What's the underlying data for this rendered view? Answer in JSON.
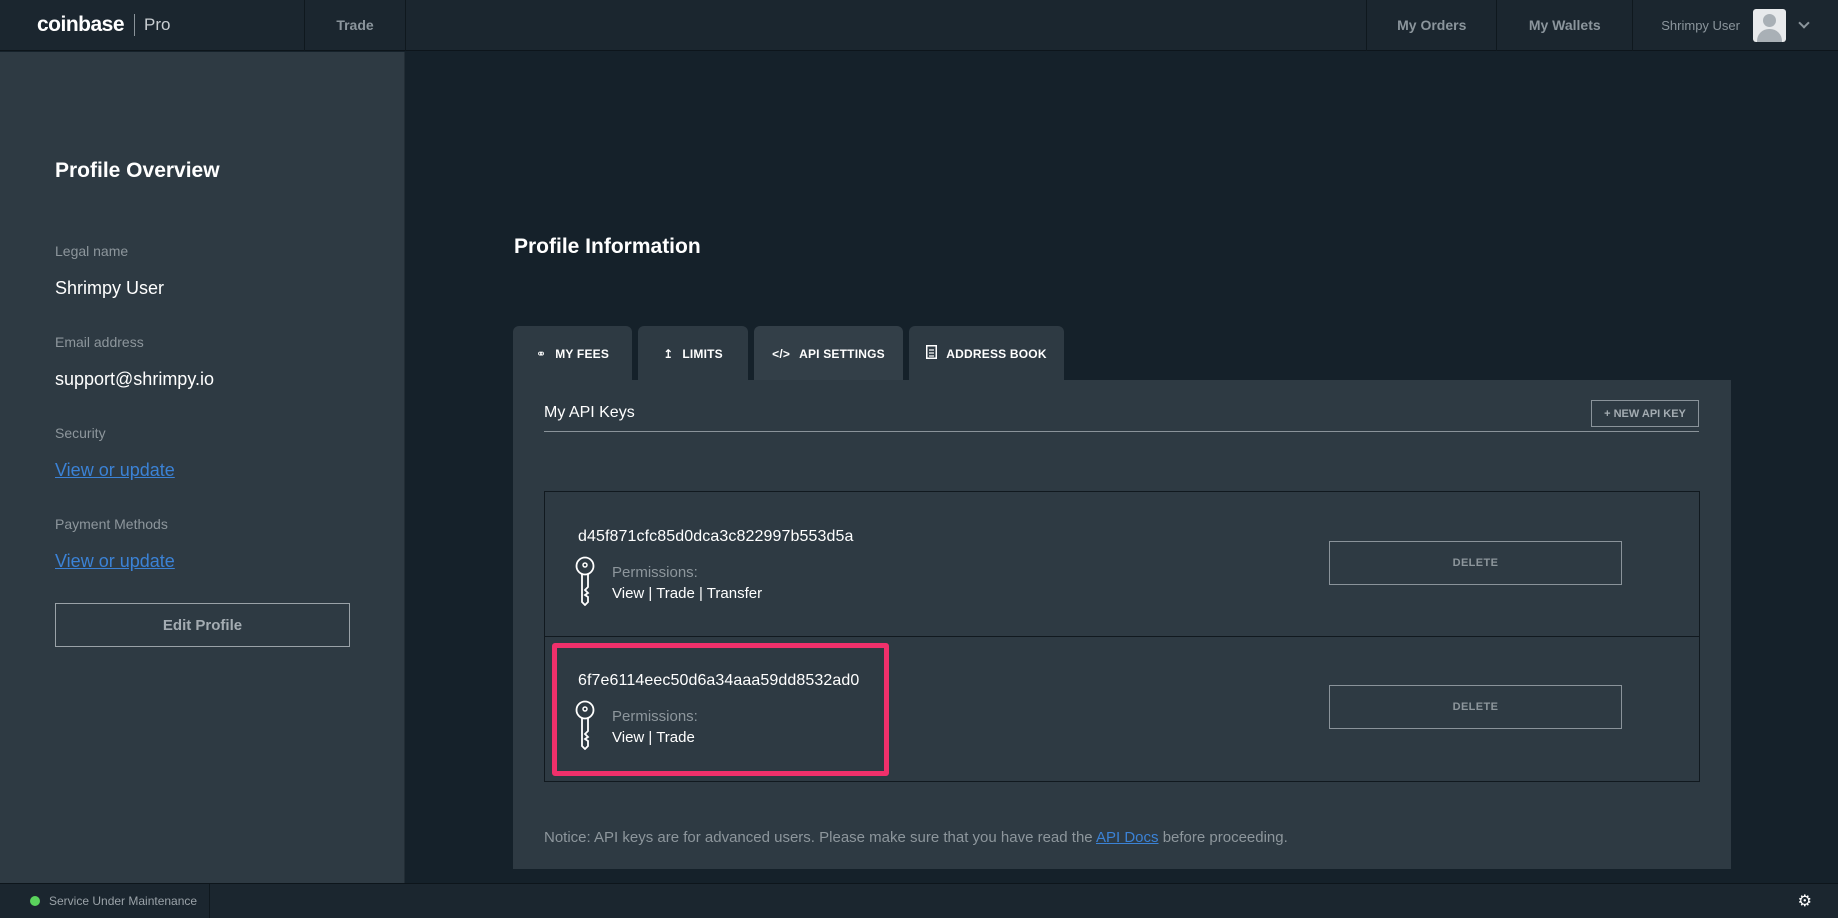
{
  "topbar": {
    "brand": "coinbase",
    "brand_sub": "Pro",
    "trade": "Trade",
    "my_orders": "My Orders",
    "my_wallets": "My Wallets",
    "user_name": "Shrimpy User"
  },
  "sidebar": {
    "title": "Profile Overview",
    "legal_name_label": "Legal name",
    "legal_name": "Shrimpy User",
    "email_label": "Email address",
    "email": "support@shrimpy.io",
    "security_label": "Security",
    "security_link": "View or update",
    "payment_label": "Payment Methods",
    "payment_link": "View or update",
    "edit_button": "Edit Profile"
  },
  "main": {
    "title": "Profile Information",
    "tabs": [
      {
        "label": "MY FEES",
        "icon": "fees-icon"
      },
      {
        "label": "LIMITS",
        "icon": "upload-icon"
      },
      {
        "label": "API SETTINGS",
        "icon": "code-icon",
        "active": true
      },
      {
        "label": "ADDRESS BOOK",
        "icon": "document-icon"
      }
    ],
    "panel_title": "My API Keys",
    "new_key_button": "+ NEW API KEY",
    "keys": [
      {
        "id": "d45f871cfc85d0dca3c822997b553d5a",
        "permissions_label": "Permissions:",
        "permissions": "View | Trade | Transfer",
        "delete": "DELETE"
      },
      {
        "id": "6f7e6114eec50d6a34aaa59dd8532ad0",
        "permissions_label": "Permissions:",
        "permissions": "View | Trade",
        "delete": "DELETE"
      }
    ],
    "notice_prefix": "Notice: API keys are for advanced users. Please make sure that you have read the",
    "notice_link": "API Docs",
    "notice_suffix": "before proceeding."
  },
  "footer": {
    "status": "Service Under Maintenance",
    "status_color": "#5ad35c"
  },
  "colors": {
    "background": "#15212a",
    "panel": "#2e3a43",
    "link": "#3b82d6",
    "highlight": "#f0306b"
  }
}
